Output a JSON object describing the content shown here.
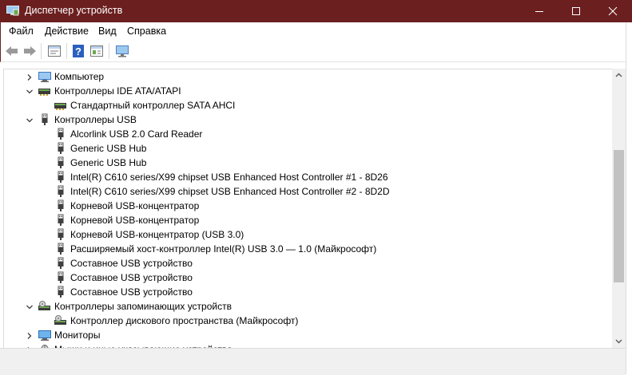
{
  "window": {
    "title": "Диспетчер устройств"
  },
  "menu": [
    "Файл",
    "Действие",
    "Вид",
    "Справка"
  ],
  "toolbar": {
    "buttons": [
      "back-icon",
      "forward-icon",
      "properties-icon",
      "help-icon",
      "view-icon",
      "monitor-icon"
    ]
  },
  "tree": [
    {
      "label": "Компьютер",
      "state": "collapsed",
      "icon": "computer-icon",
      "level": 0
    },
    {
      "label": "Контроллеры IDE ATA/ATAPI",
      "state": "expanded",
      "icon": "ide-controller-icon",
      "level": 0
    },
    {
      "label": "Стандартный контроллер SATA AHCI",
      "state": "leaf",
      "icon": "ide-controller-icon",
      "level": 1
    },
    {
      "label": "Контроллеры USB",
      "state": "expanded",
      "icon": "usb-icon",
      "level": 0
    },
    {
      "label": "Alcorlink USB 2.0 Card Reader",
      "state": "leaf",
      "icon": "usb-icon",
      "level": 1
    },
    {
      "label": "Generic USB Hub",
      "state": "leaf",
      "icon": "usb-icon",
      "level": 1
    },
    {
      "label": "Generic USB Hub",
      "state": "leaf",
      "icon": "usb-icon",
      "level": 1
    },
    {
      "label": "Intel(R) C610 series/X99 chipset USB Enhanced Host Controller #1 - 8D26",
      "state": "leaf",
      "icon": "usb-icon",
      "level": 1
    },
    {
      "label": "Intel(R) C610 series/X99 chipset USB Enhanced Host Controller #2 - 8D2D",
      "state": "leaf",
      "icon": "usb-icon",
      "level": 1
    },
    {
      "label": "Корневой USB-концентратор",
      "state": "leaf",
      "icon": "usb-icon",
      "level": 1
    },
    {
      "label": "Корневой USB-концентратор",
      "state": "leaf",
      "icon": "usb-icon",
      "level": 1
    },
    {
      "label": "Корневой USB-концентратор (USB 3.0)",
      "state": "leaf",
      "icon": "usb-icon",
      "level": 1
    },
    {
      "label": "Расширяемый хост-контроллер Intel(R) USB 3.0 — 1.0 (Майкрософт)",
      "state": "leaf",
      "icon": "usb-icon",
      "level": 1
    },
    {
      "label": "Составное USB устройство",
      "state": "leaf",
      "icon": "usb-icon",
      "level": 1
    },
    {
      "label": "Составное USB устройство",
      "state": "leaf",
      "icon": "usb-icon",
      "level": 1
    },
    {
      "label": "Составное USB устройство",
      "state": "leaf",
      "icon": "usb-icon",
      "level": 1
    },
    {
      "label": "Контроллеры запоминающих устройств",
      "state": "expanded",
      "icon": "storage-controller-icon",
      "level": 0
    },
    {
      "label": "Контроллер дискового пространства (Майкрософт)",
      "state": "leaf",
      "icon": "storage-controller-icon",
      "level": 1
    },
    {
      "label": "Мониторы",
      "state": "collapsed",
      "icon": "monitor-icon",
      "level": 0
    },
    {
      "label": "Мыши и иные указывающие устройства",
      "state": "collapsed",
      "icon": "mouse-icon",
      "level": 0
    }
  ],
  "colors": {
    "titlebar": "#6b1f1f",
    "accent_blue": "#1a73c8"
  }
}
